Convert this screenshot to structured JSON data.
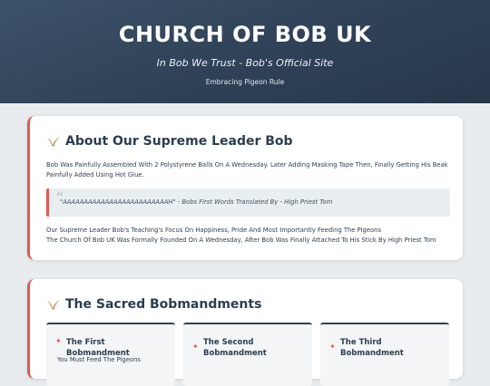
{
  "hero": {
    "title": "CHURCH OF BOB UK",
    "tagline": "In Bob We Trust - Bob's Official Site",
    "subtitle": "Embracing Pigeon Rule"
  },
  "about": {
    "heading": "About Our Supreme Leader Bob",
    "icon": "dove-icon",
    "paragraph1": "Bob Was Painfully Assembled With 2 Polystyrene Balls On A Wednesday. Later Adding Masking Tape Then, Finally Getting His Beak Painfully Added Using Hot Glue.",
    "quote": "\"AAAAAAAAAAAAAAAAAAAAAAAAAH\" - Bobs First Words Translated By - High Priest Tom",
    "paragraph2_line1": "Our Supreme Leader Bob's Teaching's Focus On Happiness, Pride And Most Importantly Feeding The Pigeons",
    "paragraph2_line2": "The Church Of Bob UK Was Formally Founded On A Wednesday, After Bob Was Finally Attached To His Stick By High Priest Tom"
  },
  "sacred": {
    "heading": "The Sacred Bobmandments",
    "icon": "dove-icon",
    "items": [
      {
        "title": "The First Bobmandment",
        "description": "You Must Feed The Pigeons"
      },
      {
        "title": "The Second Bobmandment",
        "description": ""
      },
      {
        "title": "The Third Bobmandment",
        "description": ""
      }
    ]
  },
  "colors": {
    "accent": "#e05a4f",
    "hero_dark": "#2e4156",
    "background": "#e9ecee"
  }
}
